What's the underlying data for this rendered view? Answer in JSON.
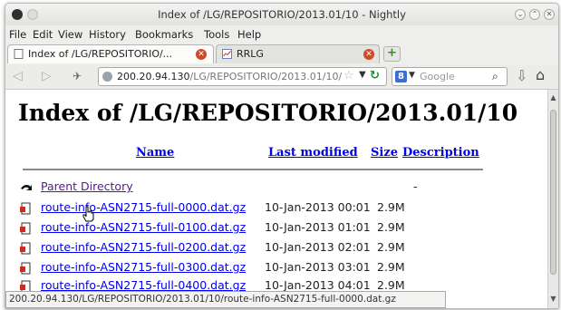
{
  "window": {
    "title": "Index of /LG/REPOSITORIO/2013.01/10 - Nightly"
  },
  "menubar": {
    "items": [
      "File",
      "Edit",
      "View",
      "History",
      "Bookmarks",
      "Tools",
      "Help"
    ]
  },
  "tabs": [
    {
      "label": "Index of /LG/REPOSITORIO/...",
      "active": true,
      "icon": "blank-page-icon"
    },
    {
      "label": "RRLG",
      "active": false,
      "icon": "chart-icon"
    }
  ],
  "navbar": {
    "url_host": "200.20.94.130",
    "url_path": "/LG/REPOSITORIO/2013.01/10/",
    "search_engine": "Google",
    "search_placeholder": "Google",
    "icons": [
      "back-icon",
      "forward-icon",
      "identity-icon",
      "star-icon",
      "reload-icon",
      "download-icon",
      "home-icon"
    ]
  },
  "page": {
    "heading": "Index of /LG/REPOSITORIO/2013.01/10",
    "columns": {
      "name": "Name",
      "last_modified": "Last modified",
      "size": "Size",
      "description": "Description"
    },
    "parent": {
      "label": "Parent Directory",
      "size": "-"
    },
    "files": [
      {
        "name": "route-info-ASN2715-full-0000.dat.gz",
        "modified": "10-Jan-2013 00:01",
        "size": "2.9M"
      },
      {
        "name": "route-info-ASN2715-full-0100.dat.gz",
        "modified": "10-Jan-2013 01:01",
        "size": "2.9M"
      },
      {
        "name": "route-info-ASN2715-full-0200.dat.gz",
        "modified": "10-Jan-2013 02:01",
        "size": "2.9M"
      },
      {
        "name": "route-info-ASN2715-full-0300.dat.gz",
        "modified": "10-Jan-2013 03:01",
        "size": "2.9M"
      },
      {
        "name": "route-info-ASN2715-full-0400.dat.gz",
        "modified": "10-Jan-2013 04:01",
        "size": "2.9M"
      }
    ]
  },
  "status": {
    "text": "200.20.94.130/LG/REPOSITORIO/2013.01/10/route-info-ASN2715-full-0000.dat.gz"
  },
  "colors": {
    "link": "#0000ee",
    "visited": "#551a8b",
    "tab_close": "#cf4a25",
    "reload": "#1e8a3a"
  }
}
